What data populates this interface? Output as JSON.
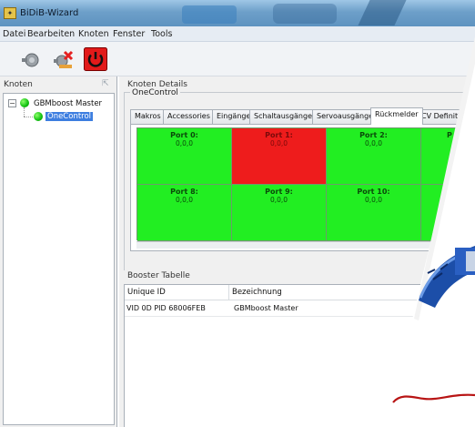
{
  "window": {
    "title": "BiDiB-Wizard",
    "app_icon_glyph": "✦"
  },
  "menu": [
    "Datei",
    "Bearbeiten",
    "Knoten",
    "Fenster",
    "Tools"
  ],
  "toolbar": {
    "buttons": [
      {
        "name": "discover-icon"
      },
      {
        "name": "disconnect-icon"
      },
      {
        "name": "power-icon"
      }
    ]
  },
  "nodes_panel": {
    "title": "Knoten",
    "collapse_glyph": "⇱",
    "toggle_glyph": "−",
    "tree": [
      {
        "label": "GBMboost Master",
        "status": "green"
      },
      {
        "label": "OneControl",
        "status": "green",
        "selected": true
      }
    ]
  },
  "details": {
    "title": "Knoten Details",
    "node_name": "OneControl",
    "tabs": [
      "Makros",
      "Accessories",
      "Eingänge",
      "Schaltausgänge",
      "Servoausgänge",
      "Rückmelder",
      "CV Definition"
    ],
    "active_tab": "Rückmelder",
    "ports": [
      {
        "name": "Port 0:",
        "value": "0,0,0",
        "state": "ok"
      },
      {
        "name": "Port 1:",
        "value": "0,0,0",
        "state": "occupied"
      },
      {
        "name": "Port 2:",
        "value": "0,0,0",
        "state": "ok"
      },
      {
        "name": "P",
        "value": "",
        "state": "ok"
      },
      {
        "name": "Port 8:",
        "value": "0,0,0",
        "state": "ok"
      },
      {
        "name": "Port 9:",
        "value": "0,0,0",
        "state": "ok"
      },
      {
        "name": "Port 10:",
        "value": "0,0,0",
        "state": "ok"
      },
      {
        "name": "",
        "value": "",
        "state": "ok"
      }
    ],
    "colors": {
      "ok": "#22ee22",
      "occupied": "#ee1c1c"
    }
  },
  "booster": {
    "title": "Booster Tabelle",
    "columns": [
      "Unique ID",
      "Bezeichnung"
    ],
    "rows": [
      {
        "unique_id": "VID 0D PID 68006FEB",
        "name": "GBMboost Master"
      }
    ]
  }
}
